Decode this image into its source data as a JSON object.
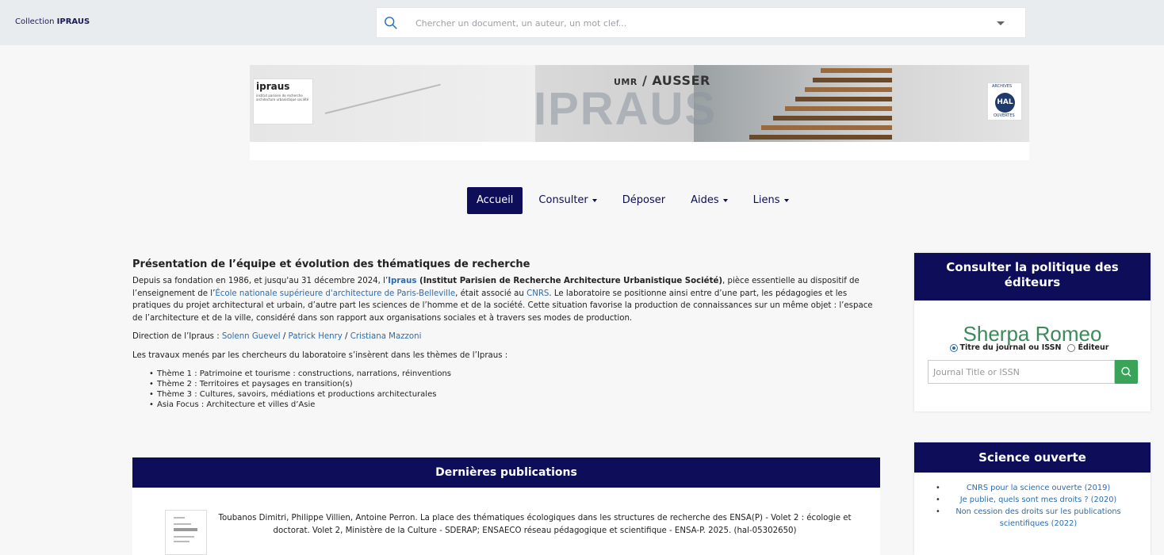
{
  "topbar": {
    "collection_prefix": "Collection",
    "collection_name": "IPRAUS",
    "search_placeholder": "Chercher un document, un auteur, un mot clef..."
  },
  "banner": {
    "logo_title": "ipraus",
    "logo_subtitle": "institut parisien de recherche architecture urbanistique société",
    "umr_prefix": "UMR",
    "umr_label": "/ AUSSER",
    "big_title": "IPRAUS",
    "hal_top": "ARCHIVES",
    "hal_label": "HAL",
    "hal_bottom": "OUVERTES"
  },
  "nav": {
    "items": [
      {
        "label": "Accueil"
      },
      {
        "label": "Consulter"
      },
      {
        "label": "Déposer"
      },
      {
        "label": "Aides"
      },
      {
        "label": "Liens"
      }
    ]
  },
  "main": {
    "title": "Présentation de l’équipe et évolution des thématiques de recherche",
    "intro": {
      "p1": "Depuis sa fondation en 1986, et jusqu'au 31 décembre 2024, l’",
      "ipraus_link": "Ipraus",
      "p2": " (Institut Parisien de Recherche Architecture Urbanistique Société)",
      "p3": ", pièce essentielle au dispositif de l’enseignement de l’",
      "ensa_link": "École nationale supérieure d'architecture de Paris-Belleville",
      "p4": ", était associé au ",
      "cnrs_link": "CNRS",
      "p5": ". Le laboratoire se positionne ainsi entre d’une part, les pédagogies et les pratiques du projet architectural et urbain, d’autre part les sciences de l’homme et de la société. Cette situation favorise la production de connaissances sur un même objet : l’espace de l’architecture et de la ville, considéré dans son rapport aux organisations sociales et à travers ses modes de production."
    },
    "direction_label": "Direction de l’Ipraus : ",
    "directors": [
      "Solenn Guevel",
      "Patrick Henry",
      "Cristiana Mazzoni"
    ],
    "director_sep": " / ",
    "themes_intro": "Les travaux menés par les chercheurs du laboratoire s’insèrent dans les thèmes de l’Ipraus :",
    "themes": [
      "Thème 1 : Patrimoine et tourisme : constructions, narrations, réinventions",
      "Thème 2 : Territoires et paysages en transition(s)",
      "Thème 3 : Cultures, savoirs, médiations et productions architecturales",
      "Asia Focus : Architecture et villes d’Asie"
    ]
  },
  "publications": {
    "header": "Dernières publications",
    "items": [
      {
        "citation": "Toubanos Dimitri, Philippe Villien, Antoine Perron. La place des thématiques écologiques dans les structures de recherche des ENSA(P) - Volet 2 : écologie et doctorat. Volet 2, Ministère de la Culture - SDERAP; ENSAECO réseau pédagogique et scientifique - ENSA-P. 2025. (hal-05302650)"
      }
    ]
  },
  "sidebar": {
    "policy": {
      "header": "Consulter la politique des éditeurs",
      "brand": "Sherpa Romeo",
      "radio_journal": "Titre du journal ou ISSN",
      "radio_publisher": "Éditeur",
      "input_placeholder": "Journal Title or ISSN"
    },
    "open_science": {
      "header": "Science ouverte",
      "links": [
        "CNRS pour la science ouverte (2019)",
        "Je publie, quels sont mes droits ? (2020)",
        "Non cession des droits sur les publications scientifiques (2022)"
      ]
    }
  },
  "colors": {
    "navy": "#0d0d5a",
    "link": "#2b6cb0",
    "green": "#3aa35a"
  }
}
